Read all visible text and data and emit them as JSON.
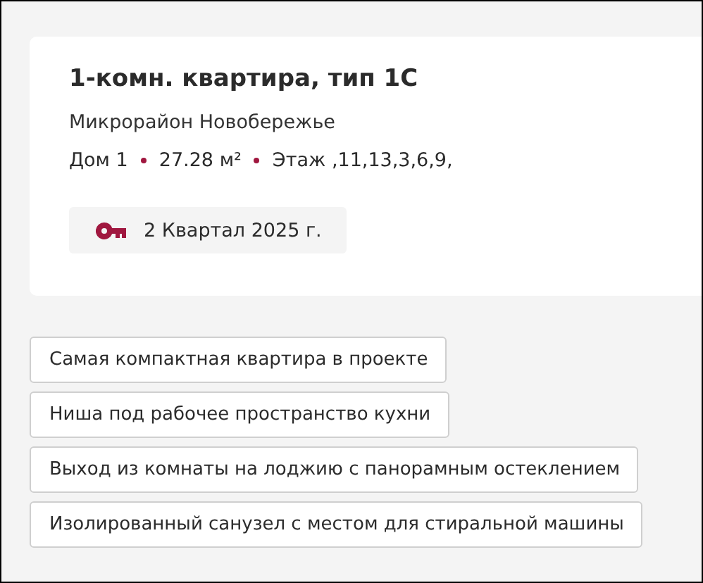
{
  "card": {
    "title": "1-комн. квартира, тип 1С",
    "district": "Микрорайон Новобережье",
    "details": [
      "Дом 1",
      "27.28 м²",
      "Этаж ,11,13,3,6,9,"
    ],
    "completion": "2 Квартал 2025 г."
  },
  "features": [
    "Самая компактная квартира в проекте",
    "Ниша под рабочее пространство кухни",
    "Выход из комнаты на лоджию с панорамным остеклением",
    "Изолированный санузел с местом для стиральной машины"
  ]
}
